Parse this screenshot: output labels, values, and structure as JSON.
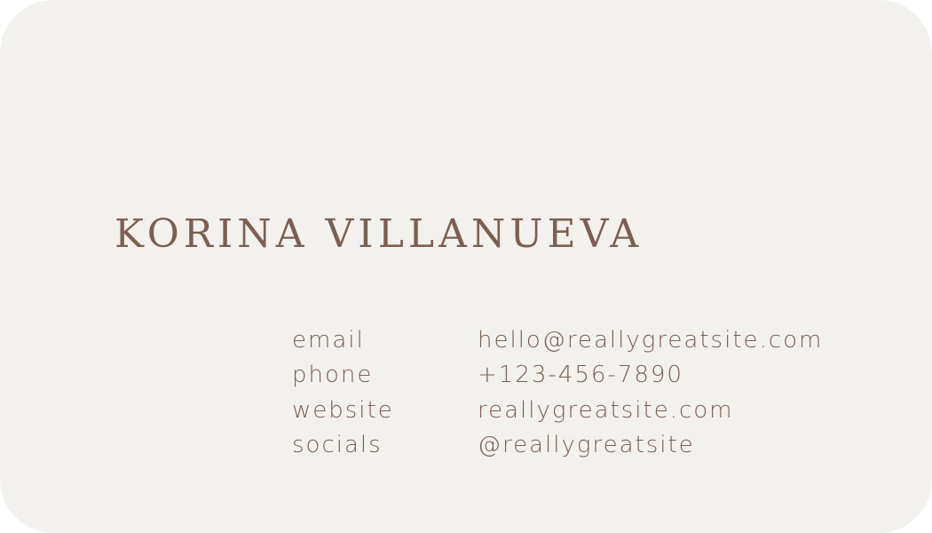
{
  "card": {
    "name": "KORINA VILLANUEVA",
    "contact": [
      {
        "label": "email",
        "value": "hello@reallygreatsite.com"
      },
      {
        "label": "phone",
        "value": "+123-456-7890"
      },
      {
        "label": "website",
        "value": "reallygreatsite.com"
      },
      {
        "label": "socials",
        "value": "@reallygreatsite"
      }
    ]
  },
  "colors": {
    "background": "#f2f1ee",
    "text": "#7b5f52"
  }
}
